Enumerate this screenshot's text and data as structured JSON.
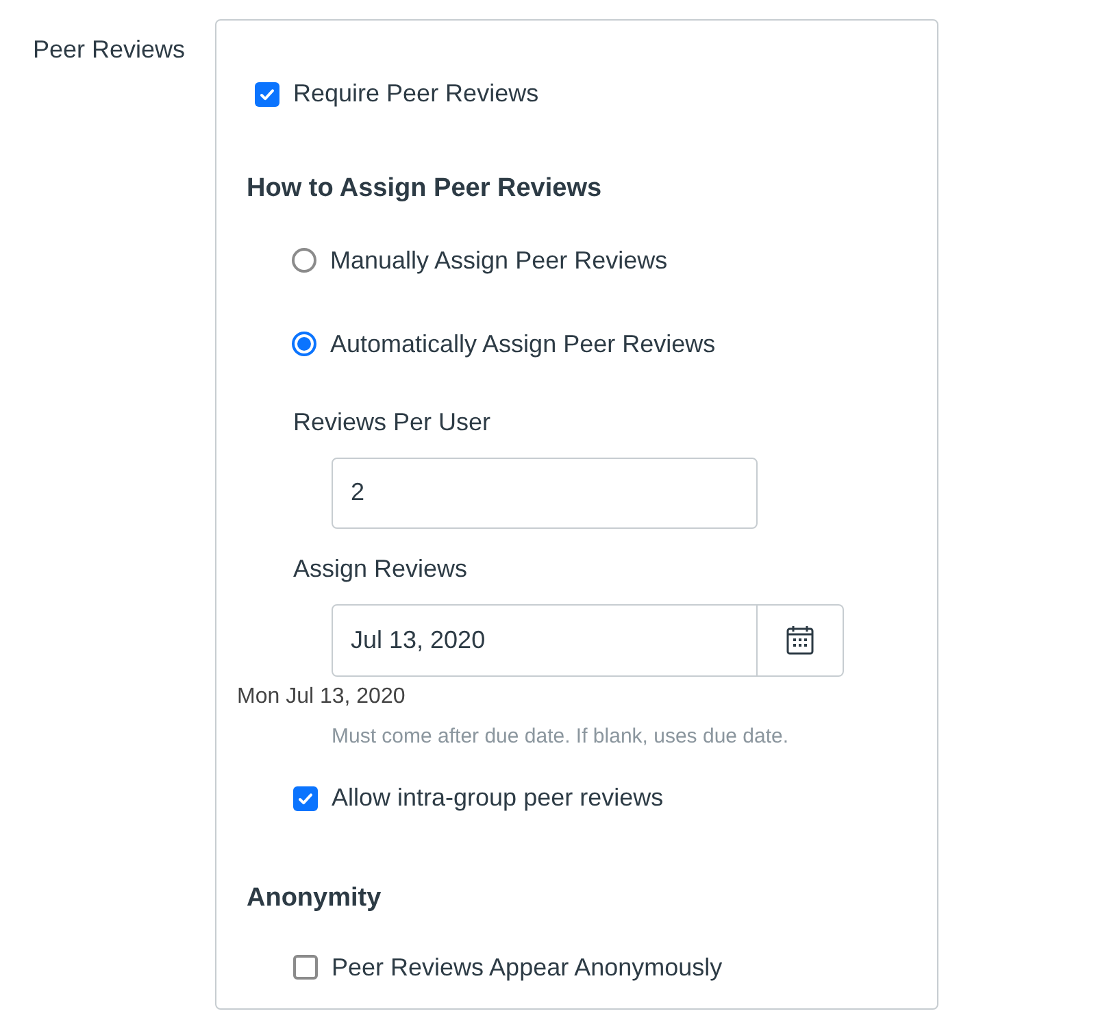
{
  "label": "Peer Reviews",
  "require": {
    "label": "Require Peer Reviews",
    "checked": true
  },
  "assign_heading": "How to Assign Peer Reviews",
  "assign_options": [
    {
      "label": "Manually Assign Peer Reviews",
      "selected": false
    },
    {
      "label": "Automatically Assign Peer Reviews",
      "selected": true
    }
  ],
  "reviews_per_user": {
    "label": "Reviews Per User",
    "value": "2"
  },
  "assign_reviews": {
    "label": "Assign Reviews",
    "value": "Jul 13, 2020",
    "parsed": "Mon Jul 13, 2020",
    "hint": "Must come after due date. If blank, uses due date."
  },
  "intra_group": {
    "label": "Allow intra-group peer reviews",
    "checked": true
  },
  "anonymity_heading": "Anonymity",
  "anonymous": {
    "label": "Peer Reviews Appear Anonymously",
    "checked": false
  }
}
